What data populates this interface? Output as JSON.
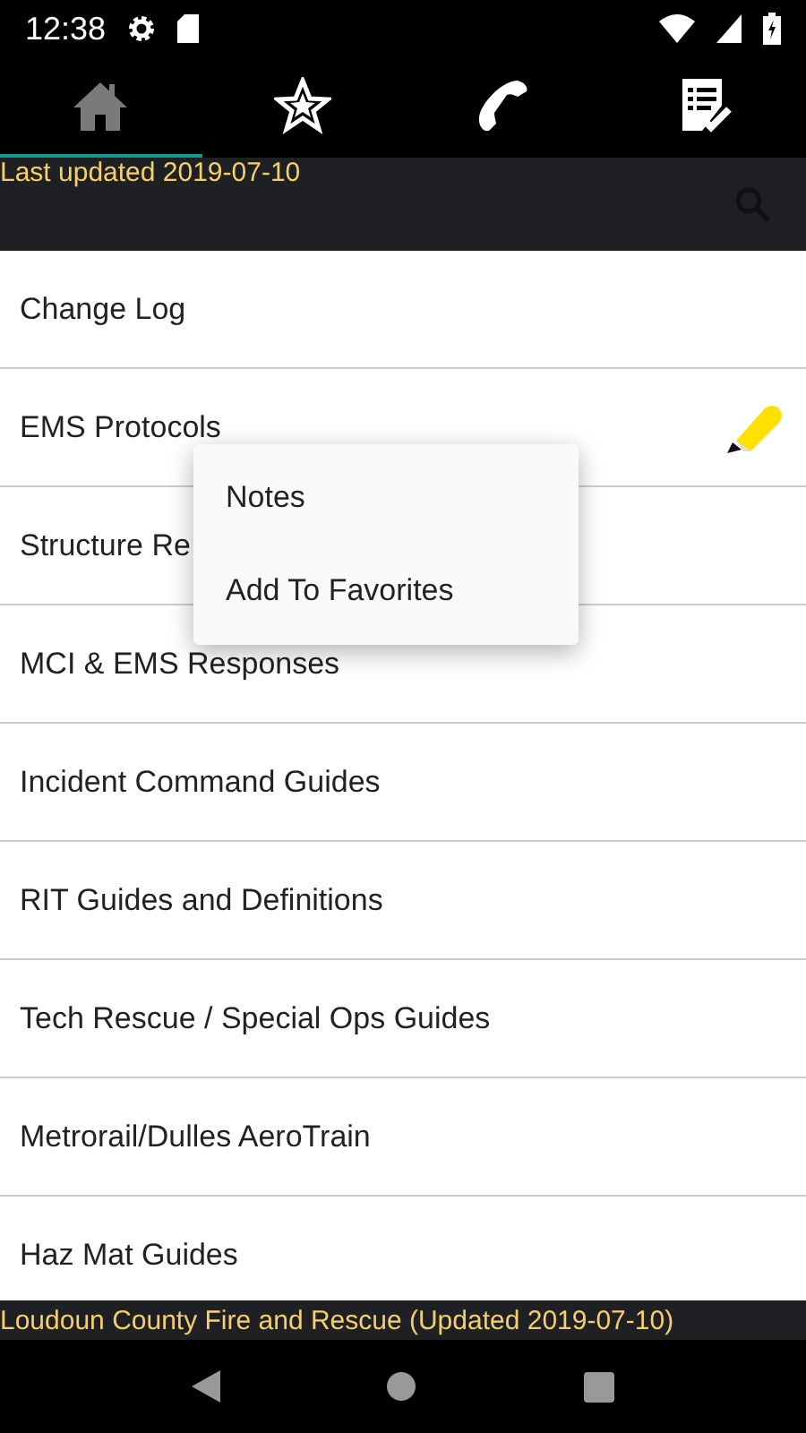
{
  "status_bar": {
    "time": "12:38"
  },
  "tabs": [
    {
      "kind": "home",
      "selected": true
    },
    {
      "kind": "star",
      "selected": false
    },
    {
      "kind": "phone",
      "selected": false
    },
    {
      "kind": "checklist",
      "selected": false
    }
  ],
  "header": {
    "text": "Last updated 2019-07-10"
  },
  "list": [
    {
      "label": "Change Log",
      "has_note": false
    },
    {
      "label": "EMS Protocols",
      "has_note": true
    },
    {
      "label": "Structure Re",
      "has_note": false
    },
    {
      "label": "MCI & EMS Responses",
      "has_note": false
    },
    {
      "label": "Incident Command Guides",
      "has_note": false
    },
    {
      "label": "RIT Guides and Definitions",
      "has_note": false
    },
    {
      "label": "Tech Rescue / Special Ops Guides",
      "has_note": false
    },
    {
      "label": "Metrorail/Dulles AeroTrain",
      "has_note": false
    },
    {
      "label": "Haz Mat Guides",
      "has_note": false
    }
  ],
  "popup_menu": [
    "Notes",
    "Add To Favorites"
  ],
  "footer": {
    "text": "Loudoun County Fire and Rescue (Updated 2019-07-10)"
  }
}
